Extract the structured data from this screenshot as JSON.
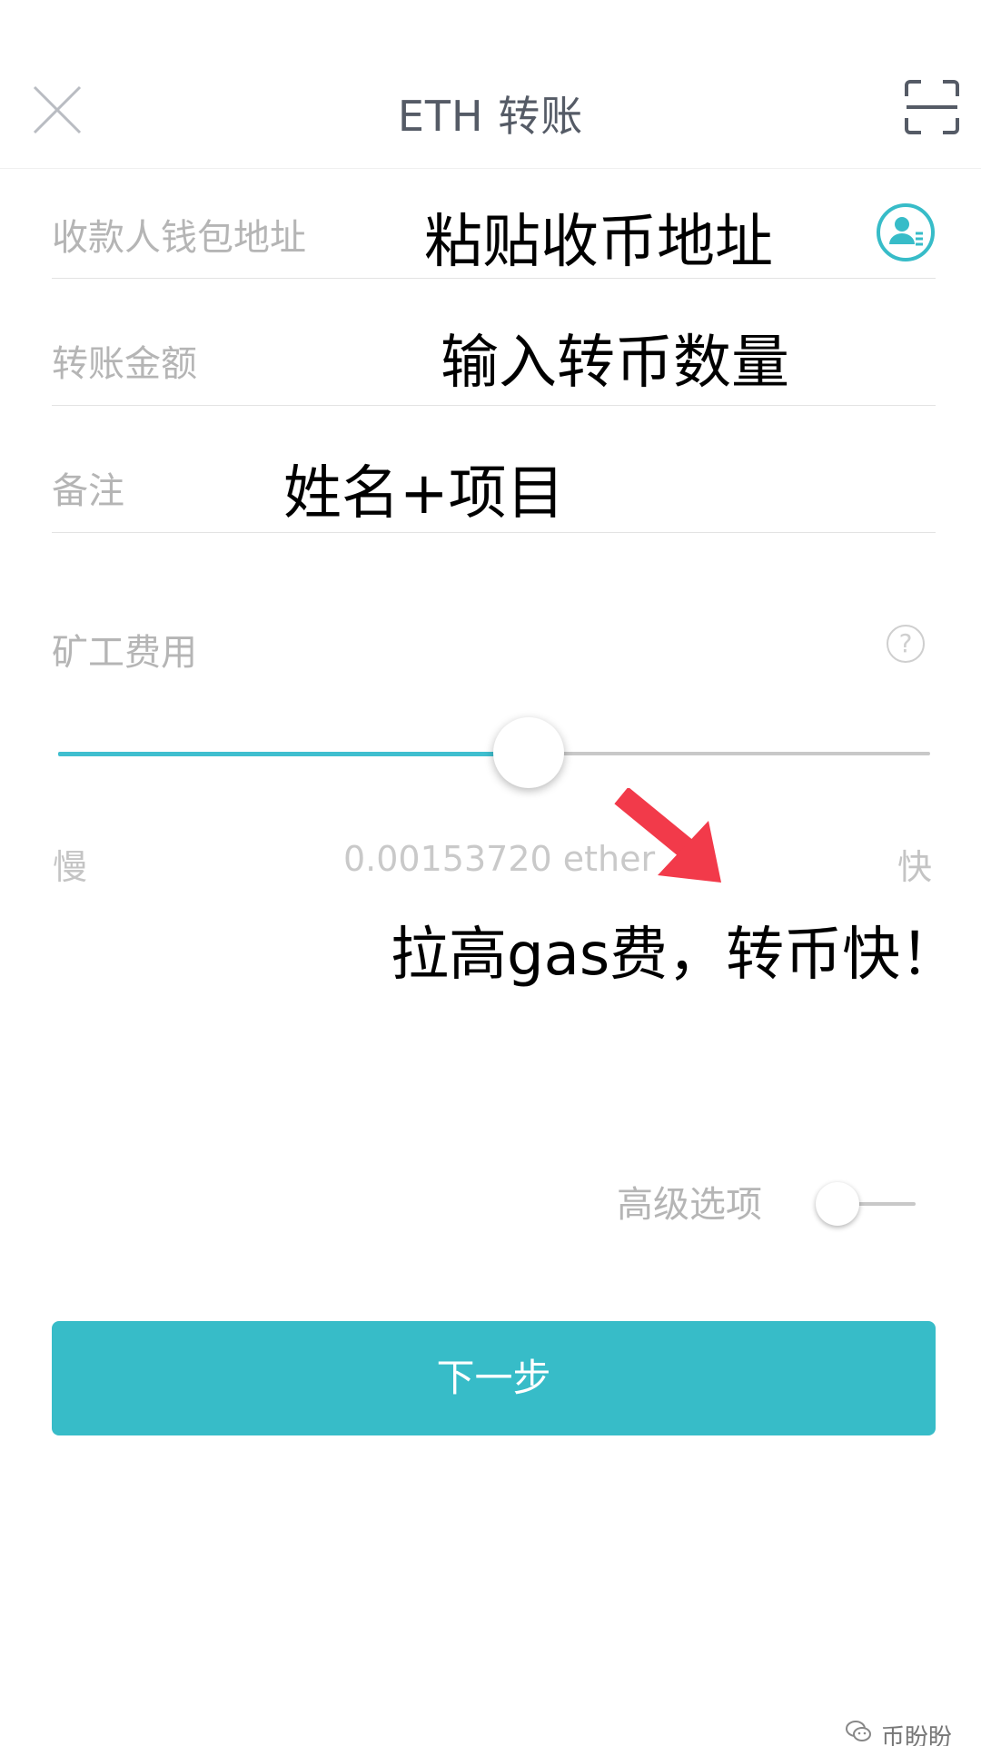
{
  "header": {
    "title": "ETH 转账",
    "close_icon": "close-icon",
    "scan_icon": "scan-icon"
  },
  "form": {
    "recipient": {
      "label": "收款人钱包地址",
      "annotation": "粘贴收币地址",
      "contact_icon": "contact-book-icon"
    },
    "amount": {
      "label": "转账金额",
      "annotation": "输入转币数量"
    },
    "memo": {
      "label": "备注",
      "annotation": "姓名+项目"
    }
  },
  "fee": {
    "label": "矿工费用",
    "help_symbol": "?",
    "slider_level": 0.54,
    "slow_label": "慢",
    "fast_label": "快",
    "value": "0.00153720 ether",
    "annotation": "拉高gas费，转币快！"
  },
  "advanced": {
    "label": "高级选项",
    "enabled": false
  },
  "next_button": {
    "label": "下一步"
  },
  "watermark": {
    "text": "币盼盼"
  },
  "colors": {
    "accent": "#37bcc8",
    "slider_fill": "#3fbfcf",
    "arrow": "#f23a4a",
    "label_gray": "#b5b5b5"
  }
}
